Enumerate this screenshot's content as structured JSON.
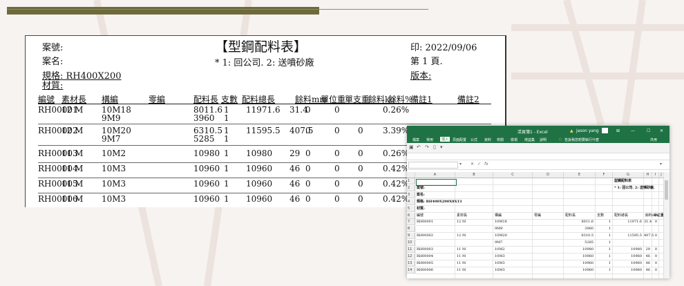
{
  "report": {
    "case_no_label": "案號:",
    "case_name_label": "案名:",
    "title": "【型鋼配料表】",
    "note": "* 1: 回公司. 2: 送噴砂廠",
    "print_date": "印: 2022/09/06",
    "page": "第 1 頁.",
    "spec": "規格: RH400X200",
    "material": "材質:",
    "version": "版本:",
    "columns": [
      "編號",
      "素材長",
      "構編",
      "零編",
      "配料長",
      "支數",
      "配料總長",
      "餘料mm",
      "單位重",
      "單支重",
      "餘料kg",
      "餘料%",
      "備註1",
      "備註2"
    ],
    "rows": [
      {
        "id": "RH00001",
        "len": "12 M",
        "part": "10M18",
        "part2": "9M9",
        "cut": "8011.6",
        "cut2": "3960",
        "qty": "1",
        "qty2": "1",
        "total": "11971.6",
        "rem": "31.4",
        "uw": "0",
        "sw": "0",
        "remkg": "",
        "pct": "0.26%"
      },
      {
        "id": "RH00002",
        "len": "12 M",
        "part": "10M20",
        "part2": "9M7",
        "cut": "6310.5",
        "cut2": "5285",
        "qty": "1",
        "qty2": "1",
        "total": "11595.5",
        "rem": "407.5",
        "uw": "0",
        "sw": "0",
        "remkg": "0",
        "pct": "3.39%"
      },
      {
        "id": "RH00003",
        "len": "11 M",
        "part": "10M2",
        "part2": "",
        "cut": "10980",
        "cut2": "",
        "qty": "1",
        "qty2": "",
        "total": "10980",
        "rem": "29",
        "uw": "0",
        "sw": "0",
        "remkg": "0",
        "pct": "0.26%"
      },
      {
        "id": "RH00004",
        "len": "11 M",
        "part": "10M3",
        "part2": "",
        "cut": "10960",
        "cut2": "",
        "qty": "1",
        "qty2": "",
        "total": "10960",
        "rem": "46",
        "uw": "0",
        "sw": "0",
        "remkg": "0",
        "pct": "0.42%"
      },
      {
        "id": "RH00005",
        "len": "11 M",
        "part": "10M3",
        "part2": "",
        "cut": "10960",
        "cut2": "",
        "qty": "1",
        "qty2": "",
        "total": "10960",
        "rem": "46",
        "uw": "0",
        "sw": "0",
        "remkg": "0",
        "pct": "0.42%"
      },
      {
        "id": "RH00006",
        "len": "11 M",
        "part": "10M3",
        "part2": "",
        "cut": "10960",
        "cut2": "",
        "qty": "1",
        "qty2": "",
        "total": "10960",
        "rem": "46",
        "uw": "0",
        "sw": "0",
        "remkg": "0",
        "pct": "0.42%"
      }
    ]
  },
  "excel": {
    "window_title": "活頁簿1 - Excel",
    "user": "jason yang",
    "ribbon_tabs": [
      "檔案",
      "常用",
      "插入",
      "頁面配置",
      "公式",
      "資料",
      "校閱",
      "檢視",
      "增益集",
      "說明"
    ],
    "active_tab": "插入",
    "search_hint": "告訴我您想要執行什麼",
    "share": "共用",
    "fx_label": "fx",
    "column_letters": [
      "A",
      "B",
      "C",
      "D",
      "E",
      "F",
      "G",
      "H",
      "I",
      "J"
    ],
    "row_numbers": [
      "1",
      "2",
      "3",
      "4",
      "5",
      "6",
      "7",
      "8",
      "9",
      "10",
      "11",
      "12",
      "13",
      "14"
    ],
    "sheet_title": "型鋼配料表",
    "sheet_note": "* 1: 回公司. 2: 送噴砂廠.",
    "case_no": "案號:",
    "case_name": "案名:",
    "spec": "規格: RH400X200X8X13",
    "material": "材質:",
    "headers": [
      "編號",
      "素材長",
      "構編",
      "零編",
      "配料長",
      "支數",
      "配料總長",
      "餘料mm",
      "單位重",
      "單支重"
    ],
    "rows": [
      [
        "RH00001",
        "12 M",
        "10M18",
        "",
        "8011.6",
        "1",
        "11971.6",
        "31.4",
        "0",
        ""
      ],
      [
        "",
        "",
        "9M9",
        "",
        "3960",
        "1",
        "",
        "",
        "",
        ""
      ],
      [
        "RH00002",
        "12 M",
        "10M20",
        "",
        "6310.5",
        "1",
        "11595.5",
        "407.5",
        "0",
        ""
      ],
      [
        "",
        "",
        "9M7",
        "",
        "5285",
        "1",
        "",
        "",
        "",
        ""
      ],
      [
        "RH00003",
        "11 M",
        "10M2",
        "",
        "10980",
        "1",
        "10980",
        "29",
        "0",
        ""
      ],
      [
        "RH00004",
        "11 M",
        "10M3",
        "",
        "10960",
        "1",
        "10960",
        "46",
        "0",
        ""
      ],
      [
        "RH00005",
        "11 M",
        "10M3",
        "",
        "10960",
        "1",
        "10960",
        "46",
        "0",
        ""
      ],
      [
        "RH00006",
        "11 M",
        "10M3",
        "",
        "10960",
        "1",
        "10960",
        "46",
        "0",
        ""
      ]
    ]
  }
}
